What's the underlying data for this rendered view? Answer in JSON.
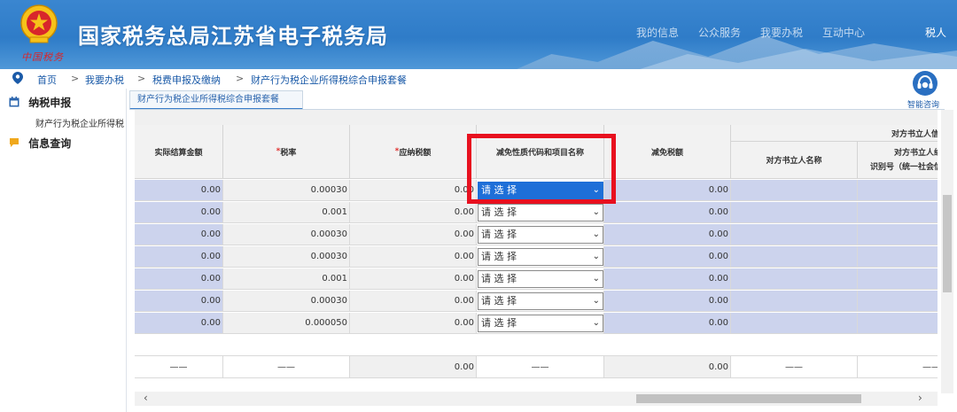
{
  "header": {
    "title": "国家税务总局江苏省电子税务局",
    "motto": "中国税务",
    "nav_items": [
      "我的信息",
      "公众服务",
      "我要办税",
      "互动中心"
    ],
    "user_label": "税人"
  },
  "breadcrumb": [
    "首页",
    "我要办税",
    "税费申报及缴纳",
    "财产行为税企业所得税综合申报套餐"
  ],
  "sidebar": {
    "items": [
      {
        "label": "纳税申报",
        "icon": "calendar-icon"
      },
      {
        "label": "信息查询",
        "icon": "chat-icon"
      }
    ],
    "sub_item": "财产行为税企业所得税"
  },
  "tab": {
    "label": "财产行为税企业所得税综合申报套餐"
  },
  "help": {
    "label": "智能咨询"
  },
  "table": {
    "headers": {
      "amount": "实际结算金额",
      "rate": "税率",
      "payable": "应纳税额",
      "exemption_code": "减免性质代码和项目名称",
      "exemption_amount": "减免税额",
      "counterparty_group": "对方书立人信",
      "counterparty_name": "对方书立人名称",
      "counterparty_id_line1": "对方书立人纳",
      "counterparty_id_line2": "识别号（统一社会信"
    },
    "required_mark": "*",
    "rows": [
      {
        "amount": "0.00",
        "rate": "0.00030",
        "payable": "0.00",
        "select": "请 选 择",
        "exempt": "0.00"
      },
      {
        "amount": "0.00",
        "rate": "0.001",
        "payable": "0.00",
        "select": "请 选 择",
        "exempt": "0.00"
      },
      {
        "amount": "0.00",
        "rate": "0.00030",
        "payable": "0.00",
        "select": "请 选 择",
        "exempt": "0.00"
      },
      {
        "amount": "0.00",
        "rate": "0.00030",
        "payable": "0.00",
        "select": "请 选 择",
        "exempt": "0.00"
      },
      {
        "amount": "0.00",
        "rate": "0.001",
        "payable": "0.00",
        "select": "请 选 择",
        "exempt": "0.00"
      },
      {
        "amount": "0.00",
        "rate": "0.00030",
        "payable": "0.00",
        "select": "请 选 择",
        "exempt": "0.00"
      },
      {
        "amount": "0.00",
        "rate": "0.000050",
        "payable": "0.00",
        "select": "请 选 择",
        "exempt": "0.00"
      }
    ],
    "totals": {
      "dash": "——",
      "payable": "0.00",
      "exempt": "0.00"
    }
  },
  "scrollbar": {
    "left_arrow": "‹",
    "right_arrow": "›"
  },
  "colors": {
    "banner": "#2f7cc8",
    "input_row": "#ccd3ed",
    "highlight": "#e8101f",
    "select_active": "#1e6fd8"
  }
}
